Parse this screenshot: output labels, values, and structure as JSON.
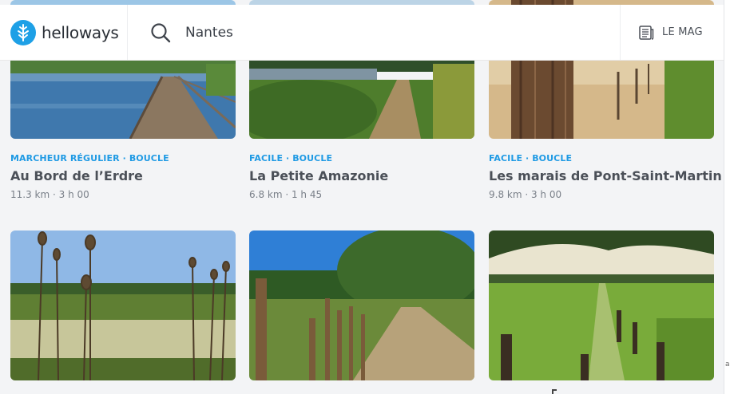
{
  "header": {
    "brand_name": "helloways",
    "search_value": "Nantes",
    "mag_label": "LE MAG"
  },
  "cards": [
    {
      "tags": "MARCHEUR RÉGULIER · BOUCLE",
      "title": "Au Bord de l’Erdre",
      "meta": "11.3 km · 3 h 00",
      "image": "lake-boardwalk"
    },
    {
      "tags": "FACILE · BOUCLE",
      "title": "La Petite Amazonie",
      "meta": "6.8 km · 1 h 45",
      "image": "river-path"
    },
    {
      "tags": "FACILE · BOUCLE",
      "title": "Les marais de Pont-Saint-Martin",
      "meta": "9.8 km · 3 h 00",
      "image": "tree-trunk-meadow"
    },
    {
      "image": "teasel-pond"
    },
    {
      "image": "fence-trail"
    },
    {
      "image": "green-meadow"
    }
  ],
  "colors": {
    "accent": "#1f9ae4",
    "title": "#4b5058",
    "meta": "#7a8089",
    "background": "#f3f4f6"
  }
}
